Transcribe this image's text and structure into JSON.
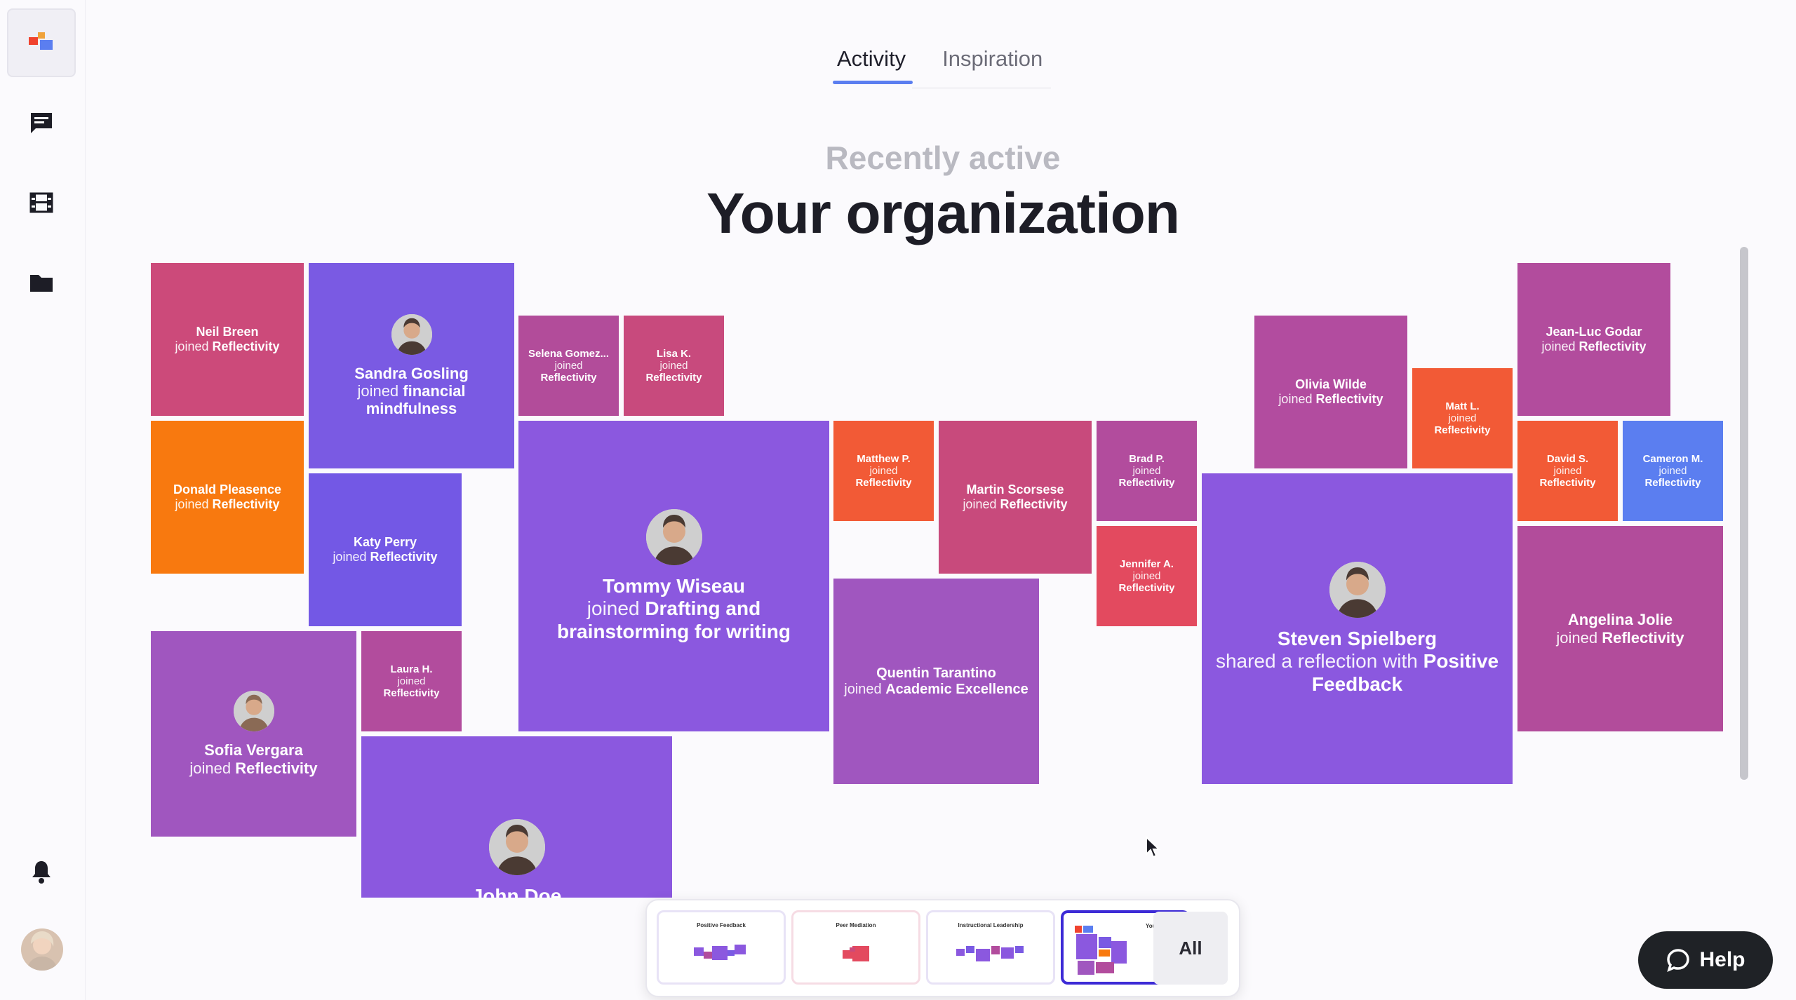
{
  "sidebar": {
    "items": [
      {
        "icon": "app-logo-icon"
      },
      {
        "icon": "chat-icon"
      },
      {
        "icon": "film-icon"
      },
      {
        "icon": "folder-icon"
      },
      {
        "icon": "bell-icon"
      },
      {
        "icon": "user-avatar"
      }
    ]
  },
  "tabs": [
    {
      "label": "Activity",
      "active": true
    },
    {
      "label": "Inspiration",
      "active": false
    }
  ],
  "header": {
    "subtitle": "Recently active",
    "title": "Your organization"
  },
  "tiles": [
    {
      "who": "Neil Breen",
      "act": "joined",
      "tgt": "Reflectivity",
      "color": "#cc4a7a"
    },
    {
      "who": "Sandra Gosling",
      "act": "joined",
      "tgt": "financial mindfulness",
      "color": "#7a5ae3",
      "avatar": true
    },
    {
      "who": "Selena Gomez...",
      "act": "joined",
      "tgt": "Reflectivity",
      "color": "#b24c9a"
    },
    {
      "who": "Lisa K.",
      "act": "joined",
      "tgt": "Reflectivity",
      "color": "#c84a7d"
    },
    {
      "who": "Donald Pleasence",
      "act": "joined",
      "tgt": "Reflectivity",
      "color": "#f8790f"
    },
    {
      "who": "Katy Perry",
      "act": "joined",
      "tgt": "Reflectivity",
      "color": "#7358e5"
    },
    {
      "who": "Tommy Wiseau",
      "act": "joined",
      "tgt": "Drafting and brainstorming for writing",
      "color": "#8b58df",
      "avatar": true
    },
    {
      "who": "Matthew P.",
      "act": "joined",
      "tgt": "Reflectivity",
      "color": "#f25a36"
    },
    {
      "who": "Martin Scorsese",
      "act": "joined",
      "tgt": "Reflectivity",
      "color": "#c84a7c"
    },
    {
      "who": "Brad P.",
      "act": "joined",
      "tgt": "Reflectivity",
      "color": "#b24c9d"
    },
    {
      "who": "Jennifer A.",
      "act": "joined",
      "tgt": "Reflectivity",
      "color": "#e34a5f"
    },
    {
      "who": "Olivia Wilde",
      "act": "joined",
      "tgt": "Reflectivity",
      "color": "#b24c9f"
    },
    {
      "who": "Matt L.",
      "act": "joined",
      "tgt": "Reflectivity",
      "color": "#f25a36"
    },
    {
      "who": "Jean-Luc Godar",
      "act": "joined",
      "tgt": "Reflectivity",
      "color": "#b24c9d"
    },
    {
      "who": "David S.",
      "act": "joined",
      "tgt": "Reflectivity",
      "color": "#f25a36"
    },
    {
      "who": "Cameron M.",
      "act": "joined",
      "tgt": "Reflectivity",
      "color": "#5b7ef0"
    },
    {
      "who": "Steven Spielberg",
      "act": "shared a reflection with",
      "tgt": "Positive Feedback",
      "color": "#8b58df",
      "avatar": true
    },
    {
      "who": "Angelina Jolie",
      "act": "joined",
      "tgt": "Reflectivity",
      "color": "#b24c9b"
    },
    {
      "who": "Quentin Tarantino",
      "act": "joined",
      "tgt": "Academic Excellence",
      "color": "#a056bf"
    },
    {
      "who": "Sofia Vergara",
      "act": "joined",
      "tgt": "Reflectivity",
      "color": "#a056bf",
      "avatar": true
    },
    {
      "who": "Laura H.",
      "act": "joined",
      "tgt": "Reflectivity",
      "color": "#b24c9d"
    },
    {
      "who": "John Doe",
      "act": "",
      "tgt": "",
      "color": "#8b58df",
      "avatar": true
    }
  ],
  "dock": {
    "thumbs": [
      {
        "label": "Positive Feedback",
        "border": "#e8e3f6"
      },
      {
        "label": "Peer Mediation",
        "border": "#f6dce4"
      },
      {
        "label": "Instructional Leadership",
        "border": "#e8e3f6"
      },
      {
        "label": "Your organi...",
        "border": "#3d2bd6",
        "active": true
      }
    ],
    "all_label": "All"
  },
  "help": {
    "label": "Help"
  }
}
